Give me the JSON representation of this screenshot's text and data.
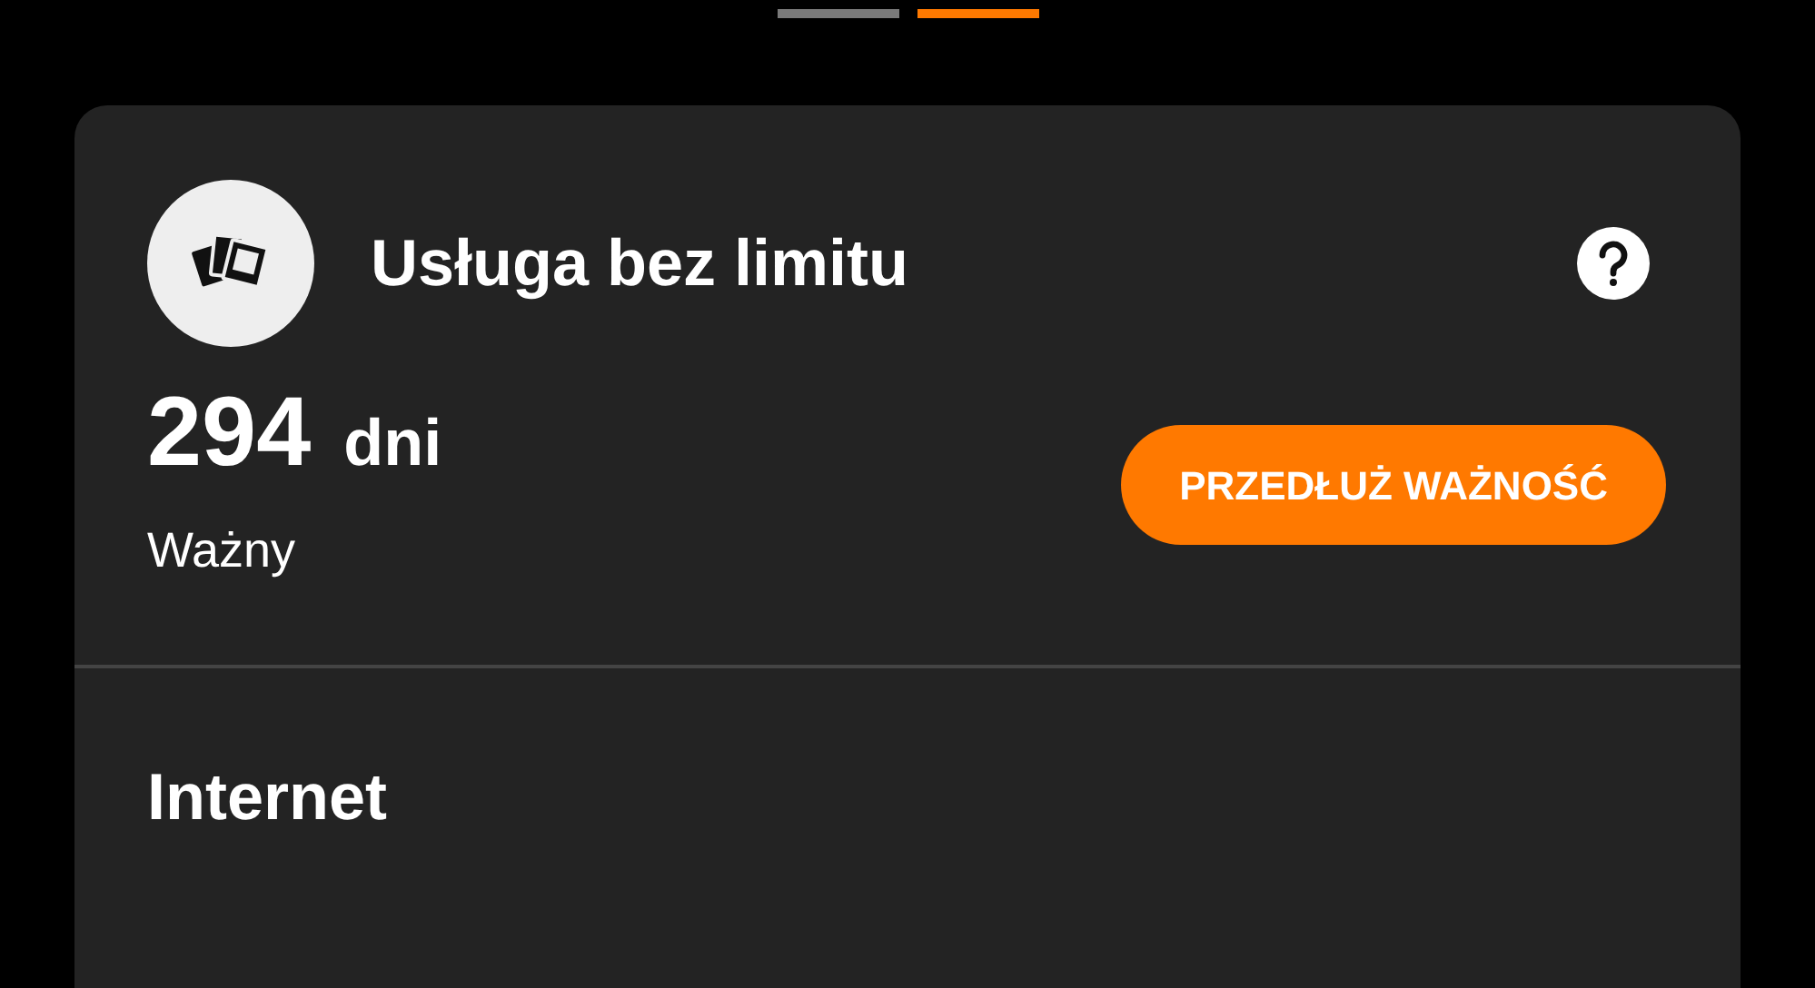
{
  "page_indicators": [
    {
      "selected": false
    },
    {
      "selected": true
    }
  ],
  "card": {
    "title": "Usługa bez limitu",
    "days_value": "294",
    "days_unit": "dni",
    "status": "Ważny",
    "extend_button": "PRZEDŁUŻ WAŻNOŚĆ",
    "section_title": "Internet"
  }
}
